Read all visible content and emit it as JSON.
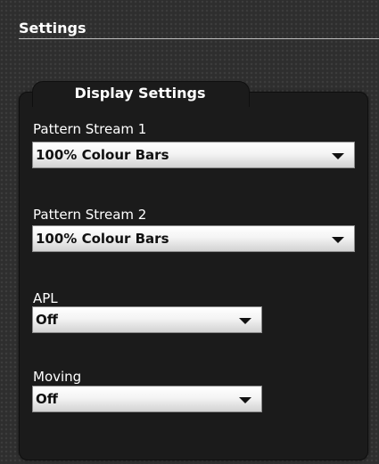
{
  "header": {
    "title": "Settings"
  },
  "panel": {
    "title": "Display Settings",
    "fields": [
      {
        "label": "Pattern Stream 1",
        "value": "100% Colour Bars"
      },
      {
        "label": "Pattern Stream 2",
        "value": "100% Colour Bars"
      },
      {
        "label": "APL",
        "value": "Off"
      },
      {
        "label": "Moving",
        "value": "Off"
      }
    ]
  },
  "colors": {
    "background": "#2e2e2e",
    "panel": "#1b1b1b",
    "text": "#ffffff",
    "select_text": "#111111"
  },
  "icons": {
    "dropdown": "chevron-down-icon"
  }
}
